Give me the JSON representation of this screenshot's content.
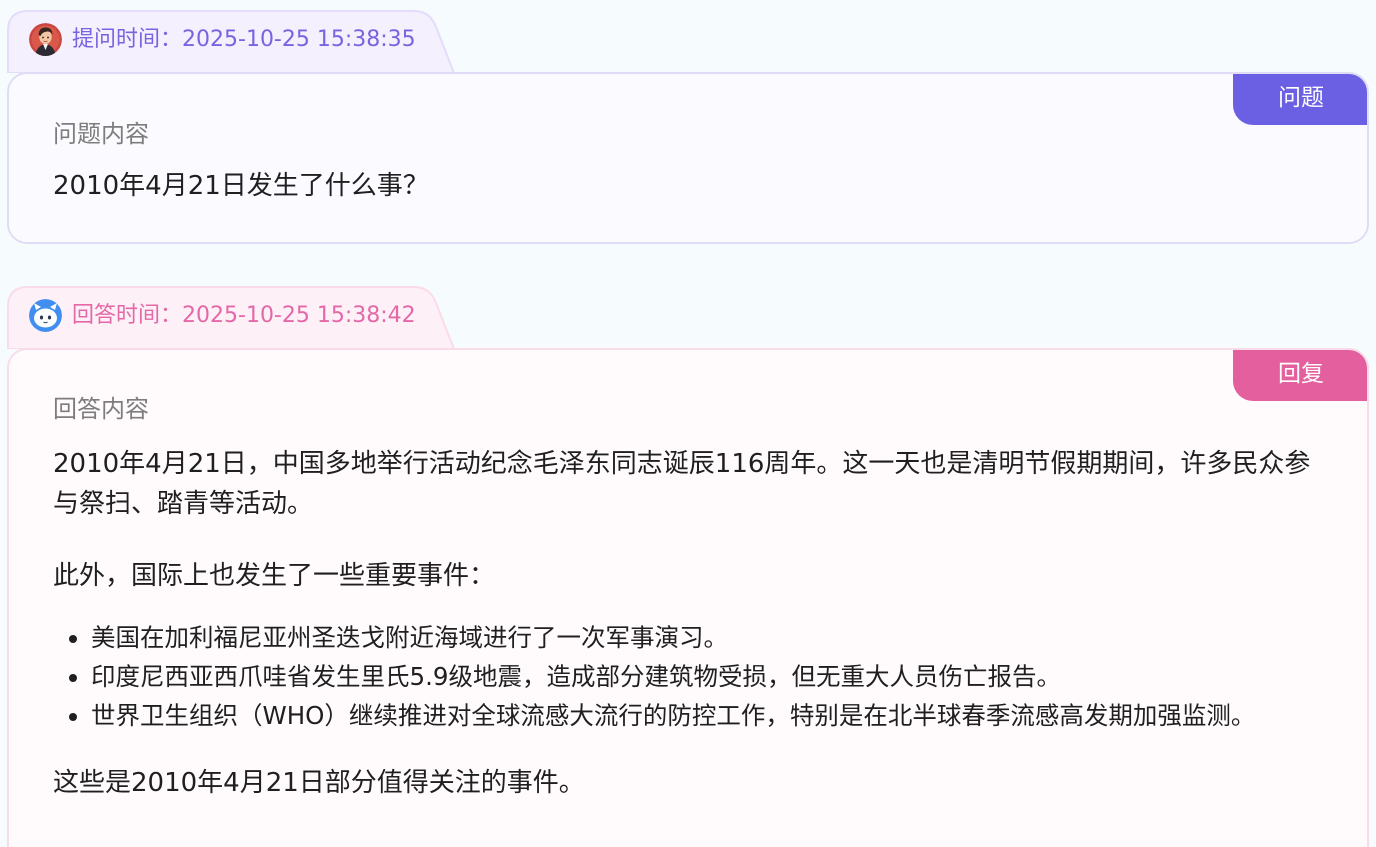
{
  "question": {
    "time_label": "提问时间：",
    "time_value": "2025-10-25 15:38:35",
    "badge": "问题",
    "section_label": "问题内容",
    "text": "2010年4月21日发生了什么事？",
    "avatar_icon": "user-avatar-icon",
    "accent_color": "#6b5fe4"
  },
  "answer": {
    "time_label": "回答时间：",
    "time_value": "2025-10-25 15:38:42",
    "badge": "回复",
    "section_label": "回答内容",
    "paragraph1": "2010年4月21日，中国多地举行活动纪念毛泽东同志诞辰116周年。这一天也是清明节假期期间，许多民众参与祭扫、踏青等活动。",
    "paragraph2": "此外，国际上也发生了一些重要事件：",
    "items": [
      "美国在加利福尼亚州圣迭戈附近海域进行了一次军事演习。",
      "印度尼西亚西爪哇省发生里氏5.9级地震，造成部分建筑物受损，但无重大人员伤亡报告。",
      "世界卫生组织（WHO）继续推进对全球流感大流行的防控工作，特别是在北半球春季流感高发期加强监测。"
    ],
    "paragraph3": "这些是2010年4月21日部分值得关注的事件。",
    "avatar_icon": "robot-avatar-icon",
    "accent_color": "#e45f9d"
  }
}
